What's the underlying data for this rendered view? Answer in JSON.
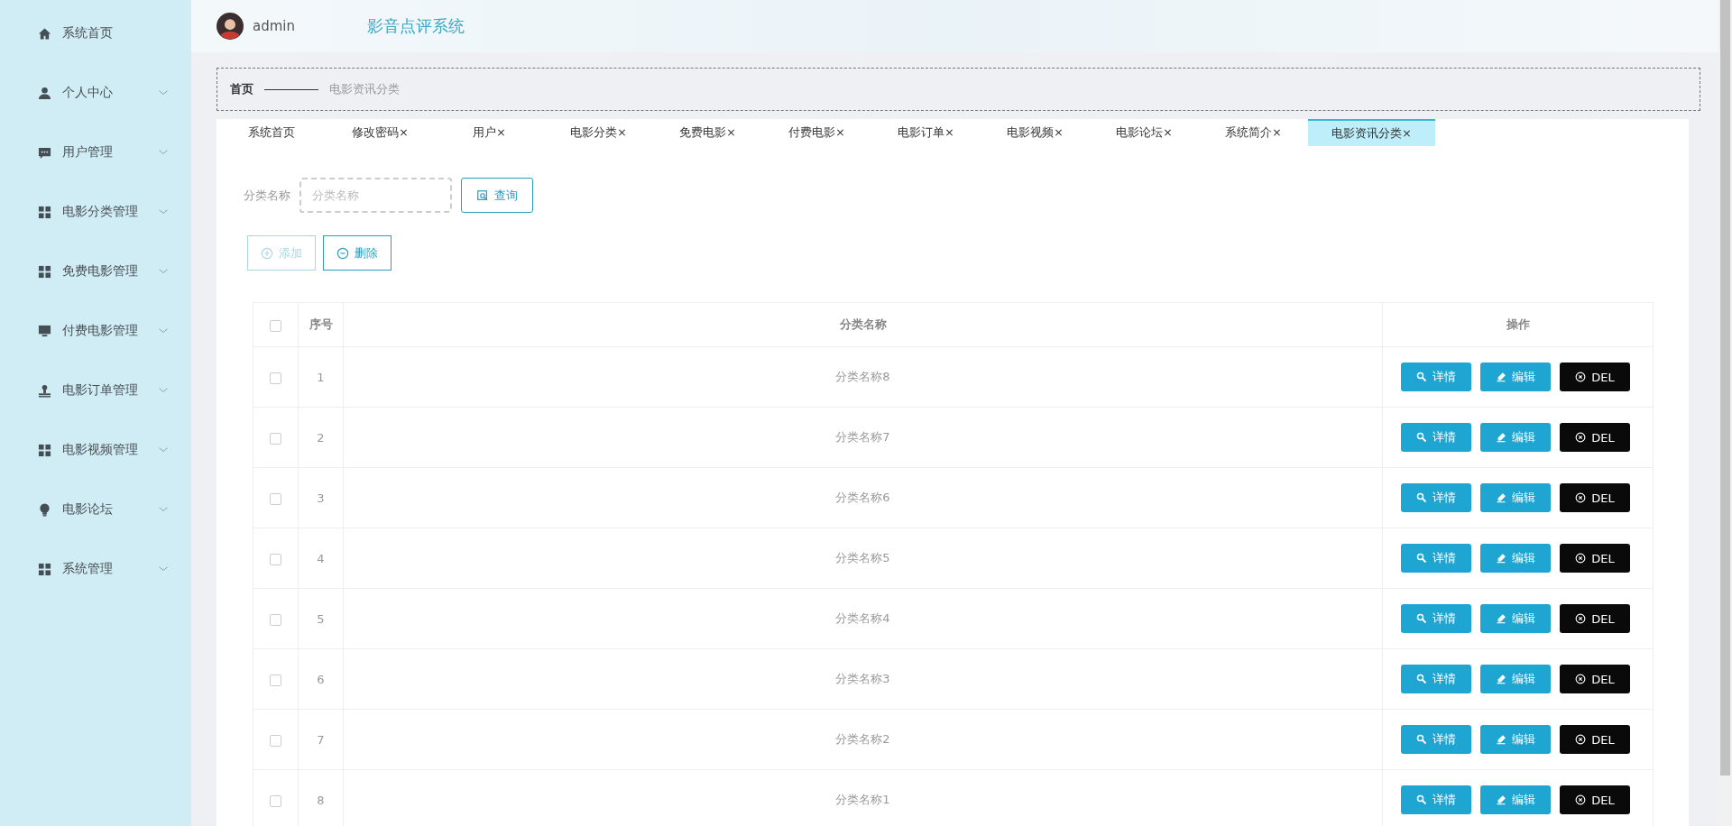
{
  "sidebar": {
    "items": [
      {
        "label": "系统首页",
        "has_submenu": false
      },
      {
        "label": "个人中心",
        "has_submenu": true
      },
      {
        "label": "用户管理",
        "has_submenu": true
      },
      {
        "label": "电影分类管理",
        "has_submenu": true
      },
      {
        "label": "免费电影管理",
        "has_submenu": true
      },
      {
        "label": "付费电影管理",
        "has_submenu": true
      },
      {
        "label": "电影订单管理",
        "has_submenu": true
      },
      {
        "label": "电影视频管理",
        "has_submenu": true
      },
      {
        "label": "电影论坛",
        "has_submenu": true
      },
      {
        "label": "系统管理",
        "has_submenu": true
      }
    ]
  },
  "header": {
    "username": "admin",
    "title": "影音点评系统"
  },
  "breadcrumb": {
    "home": "首页",
    "current": "电影资讯分类"
  },
  "tabs": [
    {
      "label": "系统首页",
      "selected": false
    },
    {
      "label": "修改密码",
      "close": "×",
      "selected": false
    },
    {
      "label": "用户",
      "close": "×",
      "selected": false
    },
    {
      "label": "电影分类",
      "close": "×",
      "selected": false
    },
    {
      "label": "免费电影",
      "close": "×",
      "selected": false
    },
    {
      "label": "付费电影",
      "close": "×",
      "selected": false
    },
    {
      "label": "电影订单",
      "close": "×",
      "selected": false
    },
    {
      "label": "电影视频",
      "close": "×",
      "selected": false
    },
    {
      "label": "电影论坛",
      "close": "×",
      "selected": false
    },
    {
      "label": "系统简介",
      "close": "×",
      "selected": false
    },
    {
      "label": "电影资讯分类",
      "close": "×",
      "selected": true
    }
  ],
  "search": {
    "label": "分类名称",
    "placeholder": "分类名称",
    "button": "查询"
  },
  "actions": [
    {
      "label": "添加",
      "kind": "add",
      "disabled": true
    },
    {
      "label": "删除",
      "kind": "delete",
      "disabled": false
    }
  ],
  "table": {
    "columns": [
      "序号",
      "分类名称",
      "操作"
    ],
    "header_checked": false,
    "rows": [
      {
        "index": "1",
        "name": "分类名称8",
        "checked": false,
        "buttons": [
          {
            "label": "详情",
            "kind": "detail"
          },
          {
            "label": "编辑",
            "kind": "edit"
          },
          {
            "label": "DEL",
            "kind": "del"
          }
        ]
      },
      {
        "index": "2",
        "name": "分类名称7",
        "checked": false,
        "buttons": [
          {
            "label": "详情",
            "kind": "detail"
          },
          {
            "label": "编辑",
            "kind": "edit"
          },
          {
            "label": "DEL",
            "kind": "del"
          }
        ]
      },
      {
        "index": "3",
        "name": "分类名称6",
        "checked": false,
        "buttons": [
          {
            "label": "详情",
            "kind": "detail"
          },
          {
            "label": "编辑",
            "kind": "edit"
          },
          {
            "label": "DEL",
            "kind": "del"
          }
        ]
      },
      {
        "index": "4",
        "name": "分类名称5",
        "checked": false,
        "buttons": [
          {
            "label": "详情",
            "kind": "detail"
          },
          {
            "label": "编辑",
            "kind": "edit"
          },
          {
            "label": "DEL",
            "kind": "del"
          }
        ]
      },
      {
        "index": "5",
        "name": "分类名称4",
        "checked": false,
        "buttons": [
          {
            "label": "详情",
            "kind": "detail"
          },
          {
            "label": "编辑",
            "kind": "edit"
          },
          {
            "label": "DEL",
            "kind": "del"
          }
        ]
      },
      {
        "index": "6",
        "name": "分类名称3",
        "checked": false,
        "buttons": [
          {
            "label": "详情",
            "kind": "detail"
          },
          {
            "label": "编辑",
            "kind": "edit"
          },
          {
            "label": "DEL",
            "kind": "del"
          }
        ]
      },
      {
        "index": "7",
        "name": "分类名称2",
        "checked": false,
        "buttons": [
          {
            "label": "详情",
            "kind": "detail"
          },
          {
            "label": "编辑",
            "kind": "edit"
          },
          {
            "label": "DEL",
            "kind": "del"
          }
        ]
      },
      {
        "index": "8",
        "name": "分类名称1",
        "checked": false,
        "buttons": [
          {
            "label": "详情",
            "kind": "detail"
          },
          {
            "label": "编辑",
            "kind": "edit"
          },
          {
            "label": "DEL",
            "kind": "del"
          }
        ]
      }
    ]
  }
}
